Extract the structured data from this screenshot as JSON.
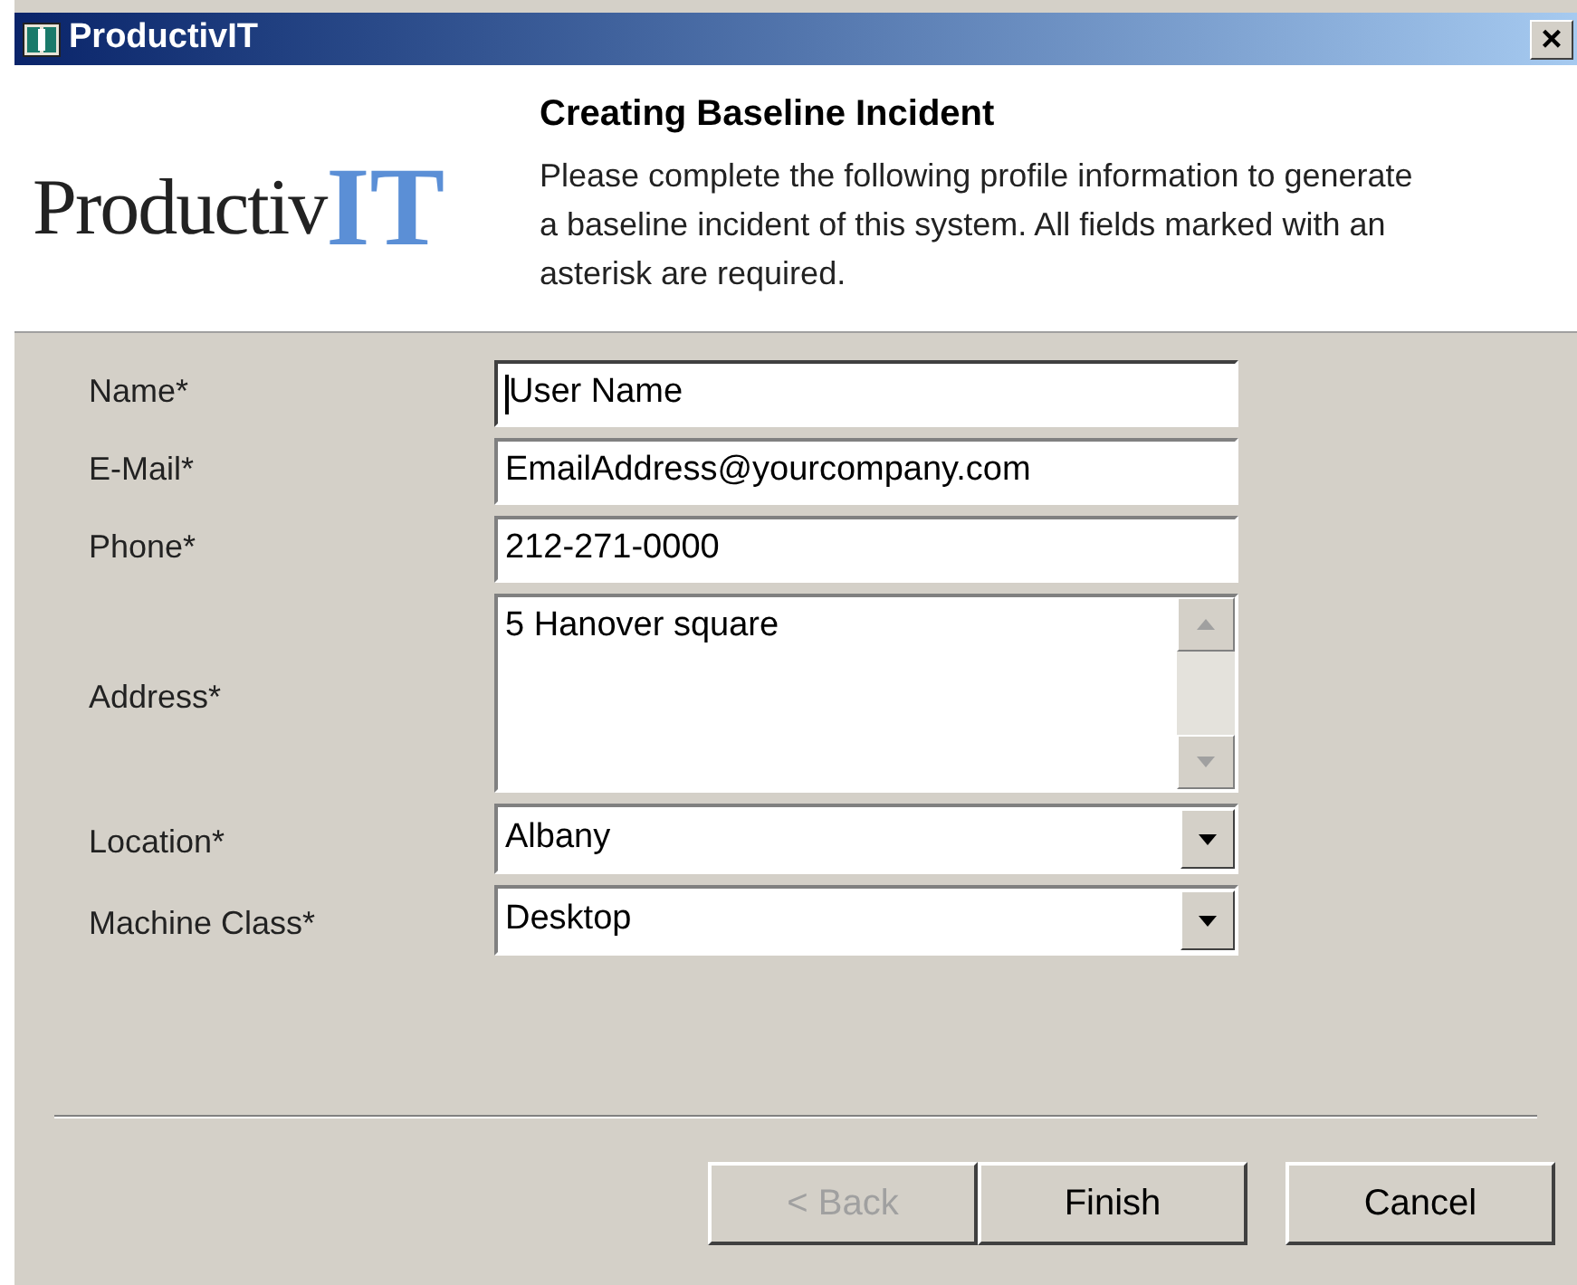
{
  "window": {
    "title": "ProductivIT",
    "close": "×"
  },
  "header": {
    "logo": {
      "word": "Productiv",
      "mark": "IT"
    },
    "title": "Creating Baseline Incident",
    "description": "Please complete the following profile information to generate a baseline incident of this system. All fields marked with an asterisk are required."
  },
  "fields": [
    {
      "label": "Name*",
      "kind": "text",
      "value": "User Name",
      "focused": true
    },
    {
      "label": "E-Mail*",
      "kind": "text",
      "value": "EmailAddress@yourcompany.com",
      "focused": false
    },
    {
      "label": "Phone*",
      "kind": "text",
      "value": "212-271-0000",
      "focused": false
    },
    {
      "label": "Address*",
      "kind": "textarea",
      "value": "5 Hanover square",
      "focused": false
    },
    {
      "label": "Location*",
      "kind": "select",
      "value": "Albany",
      "focused": false
    },
    {
      "label": "Machine Class*",
      "kind": "select",
      "value": "Desktop",
      "focused": false
    }
  ],
  "buttons": [
    {
      "label": "< Back",
      "disabled": true
    },
    {
      "label": "Finish",
      "disabled": false
    },
    {
      "label": "Cancel",
      "disabled": false
    }
  ]
}
